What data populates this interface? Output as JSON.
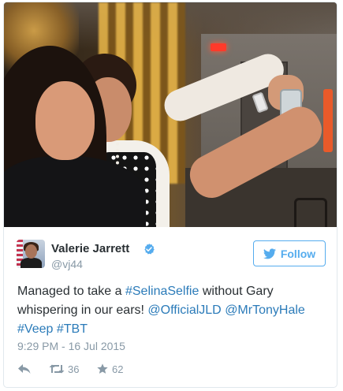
{
  "tweet": {
    "author": {
      "name": "Valerie Jarrett",
      "handle": "@vj44",
      "verified": true,
      "avatar_icon": "avatar-photo"
    },
    "follow_button": {
      "label": "Follow",
      "icon": "twitter-bird-icon",
      "color": "#55acee"
    },
    "text": {
      "part1": "Managed to take a ",
      "hashtag1": "#SelinaSelfie",
      "part2": " without Gary whispering in our ears! ",
      "mention1": "@OfficialJLD",
      "mention2": "@MrTonyHale",
      "hashtag2": "#Veep",
      "hashtag3": "#TBT",
      "link_color": "#2b7bb9"
    },
    "timestamp": "9:29 PM - 16 Jul 2015",
    "actions": {
      "reply_icon": "reply-icon",
      "retweet_icon": "retweet-icon",
      "retweet_count": "36",
      "favorite_icon": "star-icon",
      "favorite_count": "62"
    }
  }
}
